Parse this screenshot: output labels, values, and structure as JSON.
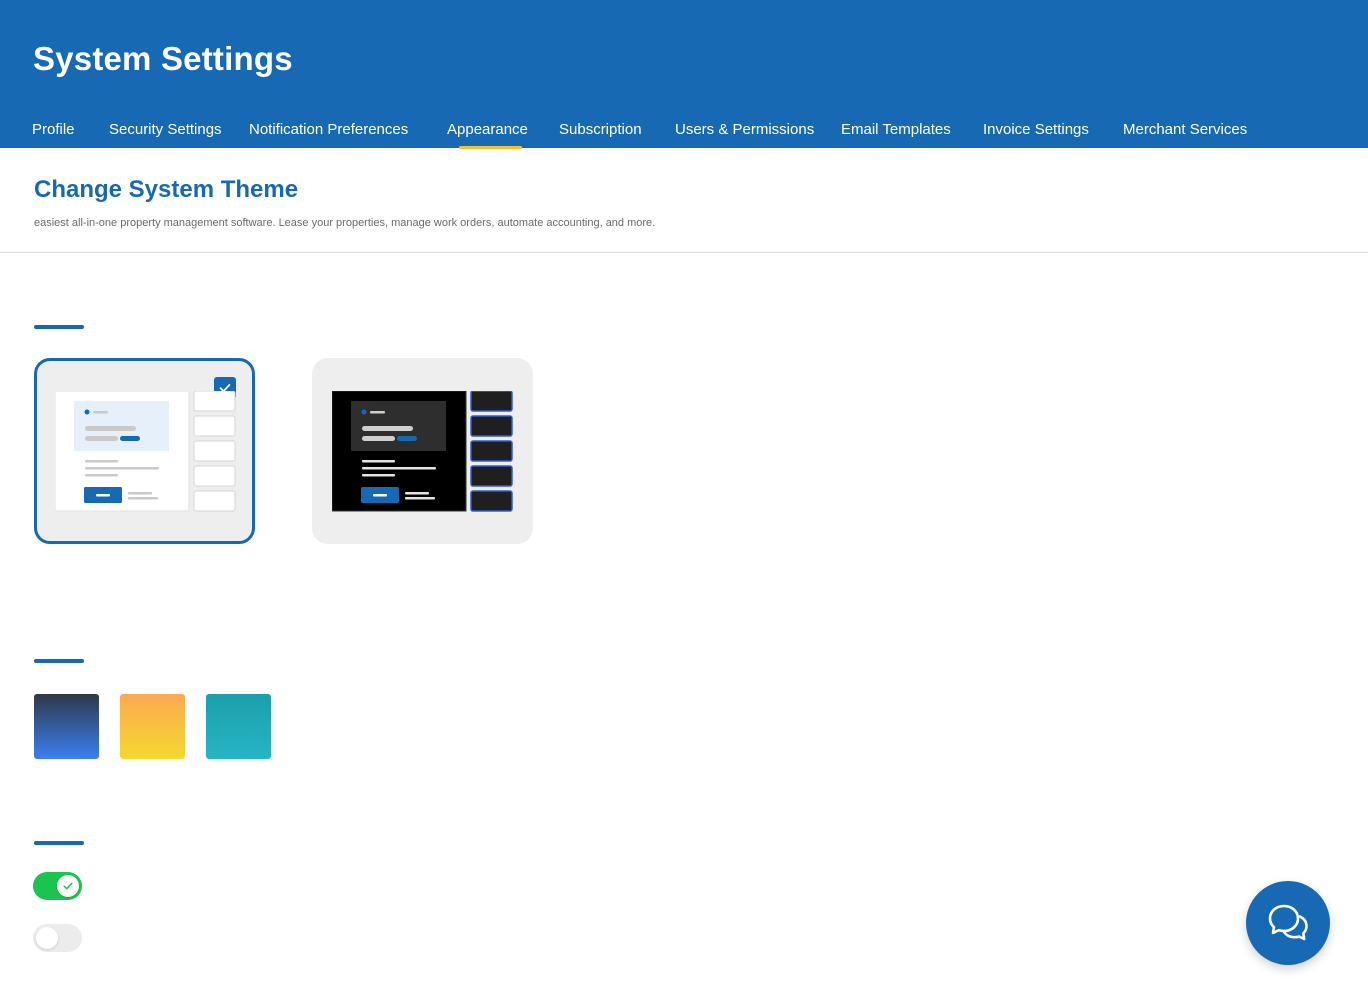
{
  "header": {
    "title": "System Settings",
    "tabs": [
      {
        "label": "Profile"
      },
      {
        "label": "Security Settings"
      },
      {
        "label": "Notification Preferences"
      },
      {
        "label": "Appearance",
        "active": true
      },
      {
        "label": "Subscription"
      },
      {
        "label": "Users & Permissions"
      },
      {
        "label": "Email Templates"
      },
      {
        "label": "Invoice Settings"
      },
      {
        "label": "Merchant Services"
      }
    ]
  },
  "main": {
    "title": "Change System Theme",
    "description": "easiest all-in-one property management software. Lease your properties, manage work orders, automate accounting, and more.",
    "themes": [
      {
        "id": "light",
        "selected": true
      },
      {
        "id": "dark",
        "selected": false
      }
    ],
    "accent_swatches": [
      {
        "from": "#2f3849",
        "to": "#3b7ff2"
      },
      {
        "from": "#fca952",
        "to": "#f4d92f"
      },
      {
        "from": "#1b9faa",
        "to": "#27b5c4"
      }
    ],
    "toggles": [
      {
        "state": "on"
      },
      {
        "state": "off"
      }
    ]
  },
  "colors": {
    "brand": "#1769b3",
    "tab_indicator": "#f4c430",
    "toggle_on": "#1bc44f",
    "toggle_off": "#ececec"
  },
  "icons": {
    "chat": "chat-bubbles-icon",
    "check": "checkmark-icon"
  }
}
